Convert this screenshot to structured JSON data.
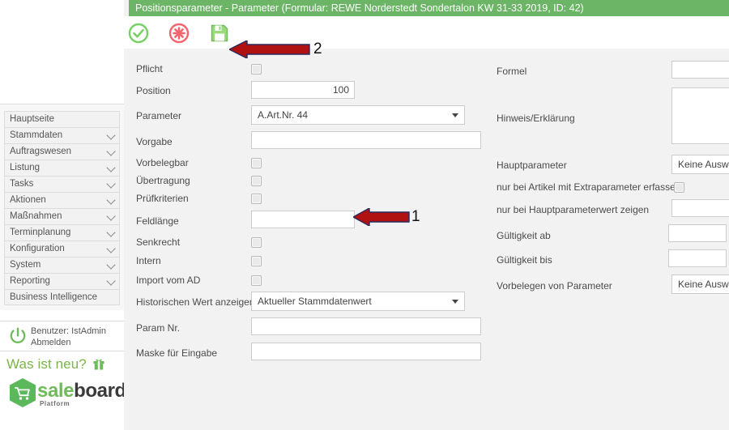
{
  "window": {
    "title": "Positionsparameter - Parameter (Formular: REWE Norderstedt Sondertalon KW 31-33 2019, ID: 42)",
    "header_color": "#6cb566"
  },
  "toolbar": {
    "ok_label": "OK / Übernehmen",
    "cancel_label": "Abbrechen",
    "save_label": "Speichern"
  },
  "annotations": {
    "arrow_one": "1",
    "arrow_two": "2",
    "arrow_color": "#b01212",
    "arrow_border_color": "#2b2b5c"
  },
  "sidebar": {
    "items": [
      {
        "label": "Hauptseite",
        "expandable": false
      },
      {
        "label": "Stammdaten",
        "expandable": true
      },
      {
        "label": "Auftragswesen",
        "expandable": true
      },
      {
        "label": "Listung",
        "expandable": true
      },
      {
        "label": "Tasks",
        "expandable": true
      },
      {
        "label": "Aktionen",
        "expandable": true
      },
      {
        "label": "Maßnahmen",
        "expandable": true
      },
      {
        "label": "Terminplanung",
        "expandable": true
      },
      {
        "label": "Konfiguration",
        "expandable": true
      },
      {
        "label": "System",
        "expandable": true
      },
      {
        "label": "Reporting",
        "expandable": true
      },
      {
        "label": "Business Intelligence",
        "expandable": false
      }
    ],
    "user": {
      "name_line": "Benutzer: IstAdmin",
      "logout_label": "Abmelden"
    },
    "whats_new": "Was ist neu?",
    "logo": {
      "text_primary": "sale",
      "text_secondary": "board",
      "subtitle": "Platform",
      "accent_color": "#6fba5a"
    }
  },
  "form": {
    "left": {
      "pflicht": {
        "label": "Pflicht",
        "checked": false
      },
      "position": {
        "label": "Position",
        "value": "100"
      },
      "parameter": {
        "label": "Parameter",
        "value": "A.Art.Nr. 44"
      },
      "vorgabe": {
        "label": "Vorgabe",
        "value": ""
      },
      "vorbelegbar": {
        "label": "Vorbelegbar",
        "checked": false
      },
      "uebertragung": {
        "label": "Übertragung",
        "checked": false
      },
      "pruefkriterien": {
        "label": "Prüfkriterien",
        "checked": false
      },
      "feldlaenge": {
        "label": "Feldlänge",
        "value": ""
      },
      "senkrecht": {
        "label": "Senkrecht",
        "checked": false
      },
      "intern": {
        "label": "Intern",
        "checked": false
      },
      "import_vom_ad": {
        "label": "Import vom AD",
        "checked": false
      },
      "historischen_wert": {
        "label": "Historischen Wert anzeigen",
        "value": "Aktueller Stammdatenwert"
      },
      "param_nr": {
        "label": "Param Nr.",
        "value": ""
      },
      "maske_eingabe": {
        "label": "Maske für Eingabe",
        "value": ""
      }
    },
    "right": {
      "formel": {
        "label": "Formel",
        "value": ""
      },
      "hinweis": {
        "label": "Hinweis/Erklärung",
        "value": ""
      },
      "hauptparameter": {
        "label": "Hauptparameter",
        "value": "Keine Auswa"
      },
      "extraparameter": {
        "label": "nur bei Artikel mit Extraparameter erfassen",
        "checked": false
      },
      "hauptparameterwert": {
        "label": "nur bei Hauptparameterwert zeigen",
        "value": ""
      },
      "gueltigkeit_ab": {
        "label": "Gültigkeit ab",
        "value": ""
      },
      "gueltigkeit_bis": {
        "label": "Gültigkeit bis",
        "value": ""
      },
      "vorbelegen": {
        "label": "Vorbelegen von Parameter",
        "value": "Keine Auswa"
      }
    }
  }
}
